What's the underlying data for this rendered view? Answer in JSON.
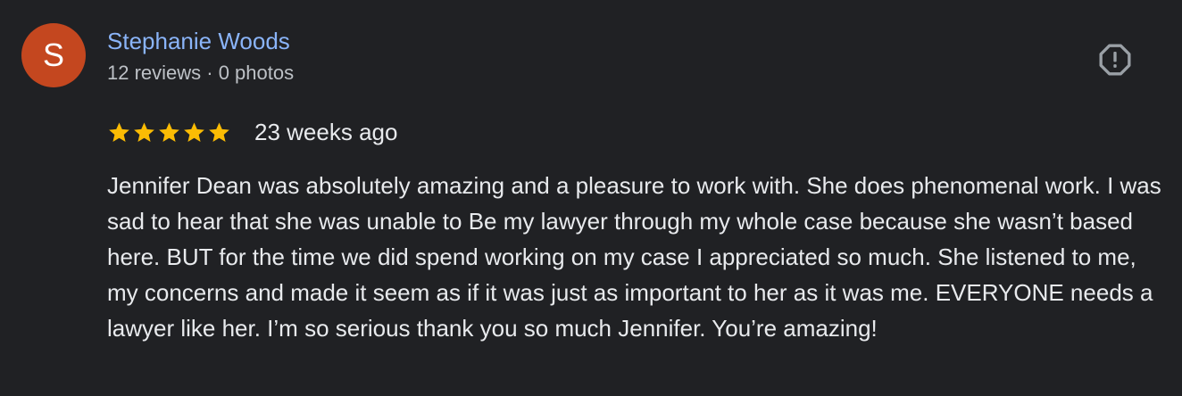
{
  "reviewer": {
    "initial": "S",
    "name": "Stephanie Woods",
    "meta": "12 reviews · 0 photos",
    "avatar_color": "#c4471f"
  },
  "actions": {
    "report_icon": "report-flag-icon"
  },
  "rating": {
    "stars": 5,
    "max_stars": 5,
    "star_color": "#fbbc04",
    "date": "23 weeks ago"
  },
  "review": {
    "text": "Jennifer Dean was absolutely amazing and a pleasure to work with. She does phenomenal work. I was sad to hear that she was unable to Be my lawyer through my whole case because she wasn’t based here. BUT for the time we did spend working on my case I appreciated so much. She listened to me, my concerns and made it seem as if it was just as important to her as it was me. EVERYONE needs a lawyer like her. I’m so serious thank you so much Jennifer. You’re amazing!"
  },
  "theme": {
    "background": "#202124",
    "name_color": "#8ab4f8"
  }
}
